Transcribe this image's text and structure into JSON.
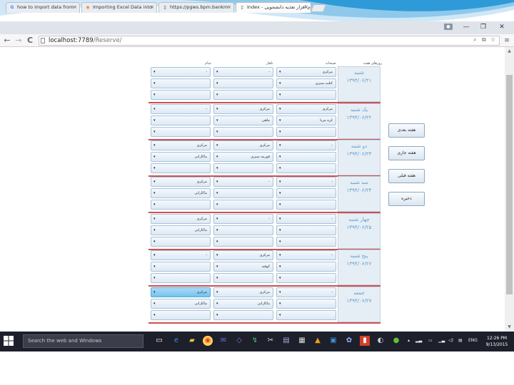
{
  "browser": {
    "tabs": [
      {
        "title": "how to import data from",
        "icon": "google-icon"
      },
      {
        "title": "Importing Excel Data into",
        "icon": "stackoverflow-icon"
      },
      {
        "title": "https://pgws.bpm.bankm",
        "icon": "page-icon"
      },
      {
        "title": "Index - نرم افزار تغذیه دانشجویی",
        "icon": "page-icon",
        "active": true
      }
    ],
    "tab_close": "×",
    "address_host": "localhost:7789",
    "address_path": "/Reserve/",
    "back_glyph": "←",
    "forward_glyph": "→",
    "reload_glyph": "C",
    "window_minimize": "—",
    "window_maximize": "❐",
    "window_close": "✕",
    "menu_glyph": "≡"
  },
  "headers": {
    "days": "روزهای هفته",
    "breakfast": "صبحانه",
    "lunch": "ناهار",
    "dinner": "شام"
  },
  "days": [
    {
      "name": "شنبه",
      "date": "۱۳۹۴/۰۶/۲۱",
      "rows": [
        [
          "مرکزی",
          "-",
          "-"
        ],
        [
          "کتلت سبزی",
          "",
          ""
        ],
        [
          "",
          "",
          ""
        ]
      ]
    },
    {
      "name": "یک شنبه",
      "date": "۱۳۹۴/۰۶/۲۲",
      "rows": [
        [
          "مرکزی",
          "مرکزی",
          "-"
        ],
        [
          "کره مربا",
          "ماهی",
          ""
        ],
        [
          "",
          "",
          ""
        ]
      ]
    },
    {
      "name": "دو شنبه",
      "date": "۱۳۹۴/۰۶/۲۳",
      "rows": [
        [
          "-",
          "مرکزی",
          "مرکزی"
        ],
        [
          "",
          "قورمه سبزی",
          "ماکارانی"
        ],
        [
          "",
          "",
          ""
        ]
      ]
    },
    {
      "name": "سه شنبه",
      "date": "۱۳۹۴/۰۶/۲۴",
      "rows": [
        [
          "-",
          "-",
          "مرکزی"
        ],
        [
          "",
          "",
          "ماکارانی"
        ],
        [
          "",
          "",
          ""
        ]
      ]
    },
    {
      "name": "چهار شنبه",
      "date": "۱۳۹۴/۰۶/۲۵",
      "rows": [
        [
          "-",
          "-",
          "مرکزی"
        ],
        [
          "",
          "",
          "ماکارانی"
        ],
        [
          "",
          "",
          ""
        ]
      ]
    },
    {
      "name": "پنج شنبه",
      "date": "۱۳۹۴/۰۶/۲۶",
      "rows": [
        [
          "-",
          "مرکزی",
          "-"
        ],
        [
          "",
          "کوفته",
          ""
        ],
        [
          "",
          "",
          ""
        ]
      ]
    },
    {
      "name": "جمعه",
      "date": "۱۳۹۴/۰۶/۲۷",
      "rows": [
        [
          "-",
          "مرکزی",
          "مرکزی"
        ],
        [
          "",
          "ماکارانی",
          "ماکارانی"
        ],
        [
          "",
          "",
          ""
        ]
      ]
    }
  ],
  "select_arrow": "▾",
  "buttons": {
    "next_week": "هفته بعدی",
    "current_week": "هفته جاری",
    "previous_week": "هفته قبلی",
    "save": "ذخیره"
  },
  "taskbar": {
    "search_placeholder": "Search the web and Windows",
    "tray_text": "ENG",
    "clock_time": "12:26 PM",
    "clock_date": "9/13/2015"
  },
  "colors": {
    "accent_blue": "#5a9acd",
    "divider_red": "#d05050",
    "highlight": "#72c3ef",
    "taskbar": "#1d1f2b"
  }
}
